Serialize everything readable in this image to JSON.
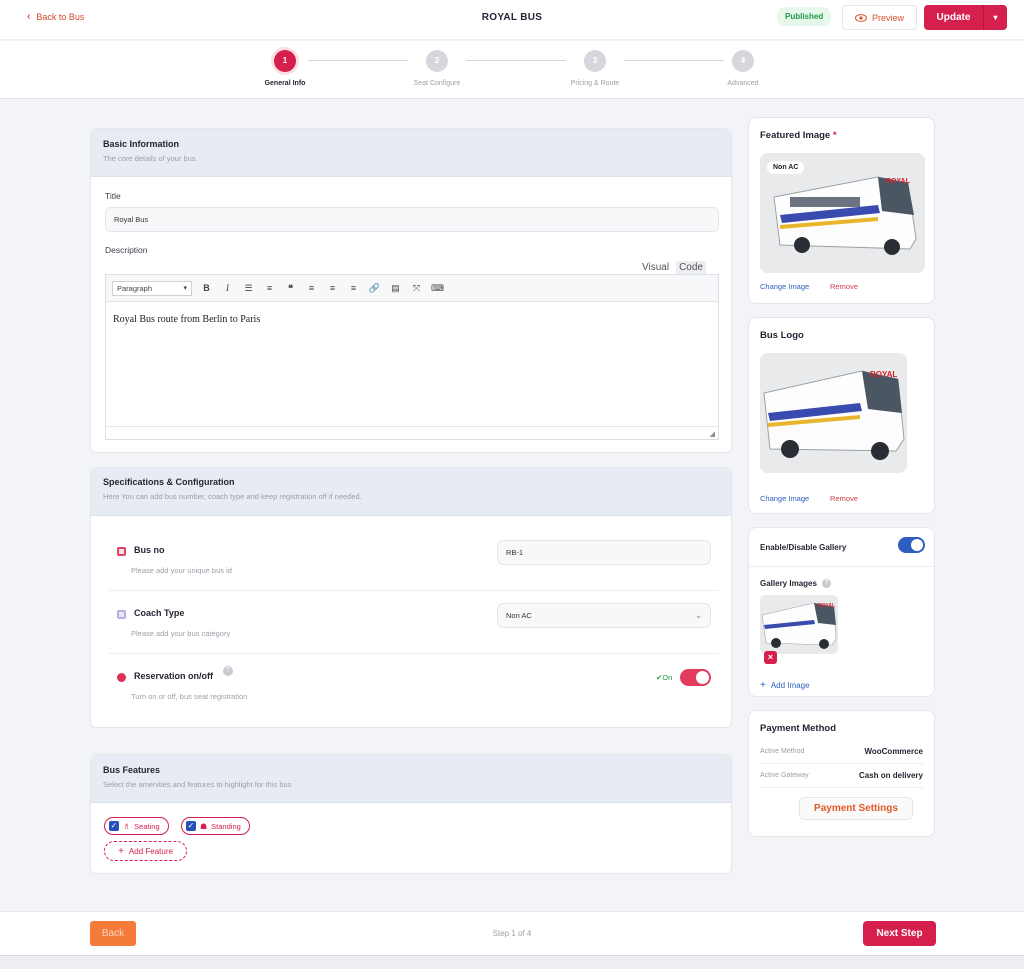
{
  "topbar": {
    "back_label": "Back to Bus",
    "title": "ROYAL BUS",
    "status": "Published",
    "preview_label": "Preview",
    "update_label": "Update"
  },
  "steps": [
    {
      "num": "1",
      "label": "General Info"
    },
    {
      "num": "2",
      "label": "Seat Configure"
    },
    {
      "num": "3",
      "label": "Pricing & Route"
    },
    {
      "num": "4",
      "label": "Advanced"
    }
  ],
  "basic": {
    "title": "Basic Information",
    "subtitle": "The core details of your bus.",
    "title_label": "Title",
    "title_value": "Royal Bus",
    "desc_label": "Description",
    "tab_visual": "Visual",
    "tab_code": "Code",
    "format_select": "Paragraph",
    "content": "Royal Bus route from Berlin to Paris"
  },
  "specs": {
    "title": "Specifications & Configuration",
    "subtitle": "Here You can add bus number, coach type and keep registration off if needed.",
    "busno_label": "Bus no",
    "busno_desc": "Please add your unique bus id",
    "busno_value": "RB-1",
    "coach_label": "Coach Type",
    "coach_desc": "Please add your bus category",
    "coach_value": "Non AC",
    "reserv_label": "Reservation on/off",
    "reserv_desc": "Turn on or off, bus seat registration",
    "reserv_state": "On"
  },
  "features": {
    "title": "Bus Features",
    "subtitle": "Select the amenities and features to highlight for this bus",
    "items": [
      "Seating",
      "Standing"
    ],
    "add_label": "Add Feature"
  },
  "sidebar": {
    "featured_title": "Featured Image",
    "required_mark": "*",
    "featured_badge": "Non AC",
    "change_label": "Change Image",
    "remove_label": "Remove",
    "logo_title": "Bus Logo",
    "logo_change_label": "Change Image",
    "logo_remove_label": "Remove",
    "gallery_toggle_label": "Enable/Disable Gallery",
    "gallery_images_label": "Gallery Images",
    "add_image_label": "Add Image",
    "payment_title": "Payment Method",
    "active_method_label": "Active Method",
    "active_method_value": "WooCommerce",
    "active_gateway_label": "Active Gateway",
    "active_gateway_value": "Cash on delivery",
    "payment_settings_label": "Payment Settings"
  },
  "footer": {
    "back_label": "Back",
    "step_text": "Step 1 of 4",
    "next_label": "Next Step"
  },
  "colors": {
    "accent": "#d51f4d",
    "orange": "#f47b3a",
    "blue": "#2d5fc2"
  }
}
